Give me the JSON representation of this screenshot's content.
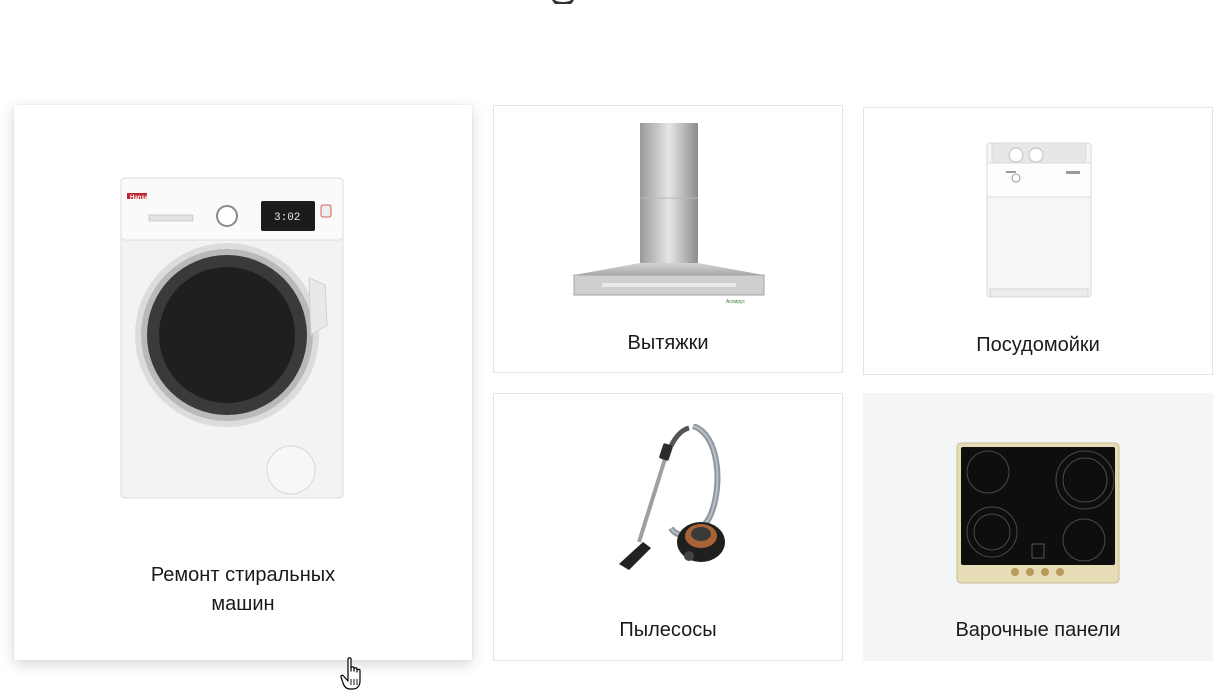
{
  "cards": [
    {
      "title": "Ремонт стиральных машин",
      "image": "washing-machine-image",
      "brand_text": "Hansa",
      "display_text": "3:02"
    },
    {
      "title": "Вытяжки",
      "image": "cooker-hood-image",
      "watermark": "Аспирус"
    },
    {
      "title": "Посудомойки",
      "image": "dishwasher-image"
    },
    {
      "title": "Пылесосы",
      "image": "vacuum-cleaner-image"
    },
    {
      "title": "Варочные панели",
      "image": "hob-image"
    }
  ],
  "colors": {
    "card_border": "#e4e4e4",
    "card_hover_background": "#f4f5f7",
    "text": "#1a1a1a"
  }
}
